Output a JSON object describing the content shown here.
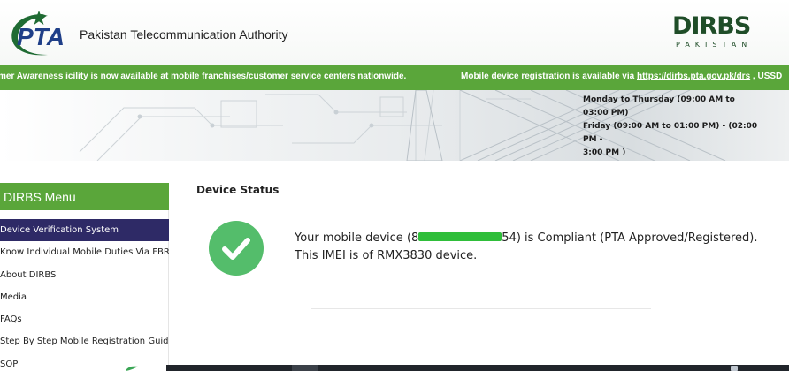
{
  "header": {
    "org_name": "Pakistan Telecommunication Authority",
    "logo_text": "PTA",
    "dirbs_logo": {
      "title": "DIRBS",
      "subtitle": "PAKISTAN"
    }
  },
  "ticker": {
    "left_text": "mer Awareness  icility is now available at mobile franchises/customer service centers nationwide.",
    "right_prefix": "Mobile device registration is available via ",
    "right_link": "https://dirbs.pta.gov.pk/drs",
    "right_suffix": " , USSD"
  },
  "banner": {
    "hours": [
      "Monday to Thursday (09:00 AM to 03:00 PM)",
      "Friday (09:00 AM to 01:00 PM) - (02:00 PM -",
      "3:00 PM )"
    ]
  },
  "sidebar": {
    "title": "DIRBS Menu",
    "items": [
      {
        "label": "Device Verification System"
      },
      {
        "label": "Know Individual Mobile Duties Via FBR"
      },
      {
        "label": "About DIRBS"
      },
      {
        "label": "Media"
      },
      {
        "label": "FAQs"
      },
      {
        "label": "Step By Step Mobile Registration Guide"
      },
      {
        "label": "SOP"
      }
    ],
    "active_index": 0
  },
  "main": {
    "section_title": "Device Status",
    "status_prefix": "Your mobile device (8",
    "status_suffix": "54) is Compliant (PTA Approved/Registered).",
    "device_line": "This IMEI is of RMX3830 device."
  },
  "colors": {
    "green": "#5aa63a",
    "menu_active": "#2e2a66",
    "check_green": "#54bd6b",
    "dirbs_dark_green": "#1f4d28"
  },
  "icons": {
    "status": "check-circle-icon",
    "pta_logo": "pta-logo-icon",
    "dirbs_logo": "dirbs-logo-icon"
  }
}
